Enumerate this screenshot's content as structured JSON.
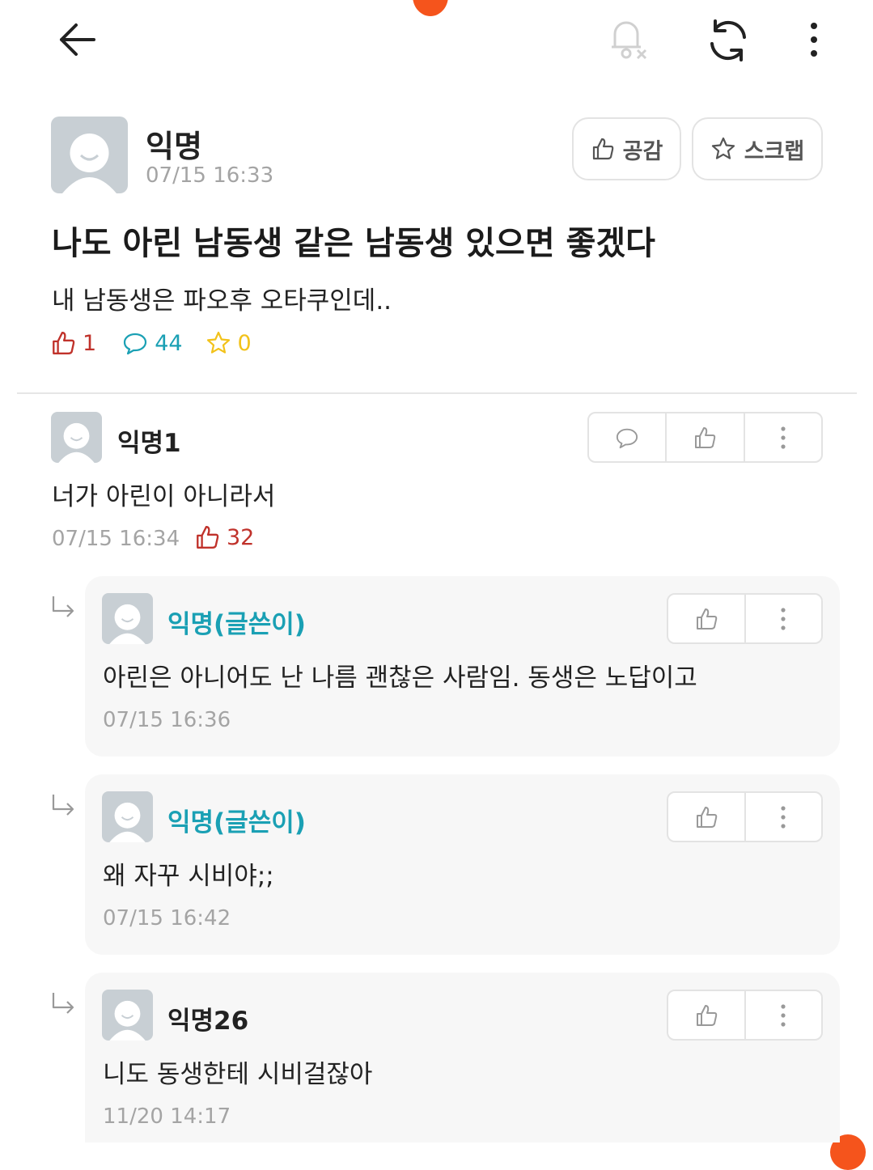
{
  "post": {
    "author": "익명",
    "time": "07/15 16:33",
    "like_button": "공감",
    "scrap_button": "스크랩",
    "title": "나도 아린 남동생 같은 남동생 있으면 좋겠다",
    "body": "내 남동생은 파오후 오타쿠인데..",
    "stats": {
      "likes": "1",
      "comments": "44",
      "scraps": "0"
    }
  },
  "comments": [
    {
      "author": "익명1",
      "text": "너가 아린이 아니라서",
      "time": "07/15 16:34",
      "likes": "32"
    }
  ],
  "replies": [
    {
      "author": "익명(글쓴이)",
      "text": "아린은 아니어도 난 나름 괜찮은 사람임. 동생은 노답이고",
      "time": "07/15 16:36"
    },
    {
      "author": "익명(글쓴이)",
      "text": "왜 자꾸 시비야;;",
      "time": "07/15 16:42"
    },
    {
      "author": "익명26",
      "text": "니도 동생한테 시비걸잖아",
      "time": "11/20 14:17"
    }
  ],
  "icons": {
    "back": "back-arrow-icon",
    "bell": "bell-off-icon",
    "refresh": "refresh-icon",
    "more": "more-vertical-icon",
    "like": "thumbs-up-icon",
    "comment": "comment-bubble-icon",
    "star": "star-icon",
    "reply": "reply-arrow-icon"
  },
  "colors": {
    "accent_orange": "#f5541c",
    "author_teal": "#1aa0b4",
    "like_red": "#c0322b",
    "scrap_yellow": "#f2c21a"
  }
}
